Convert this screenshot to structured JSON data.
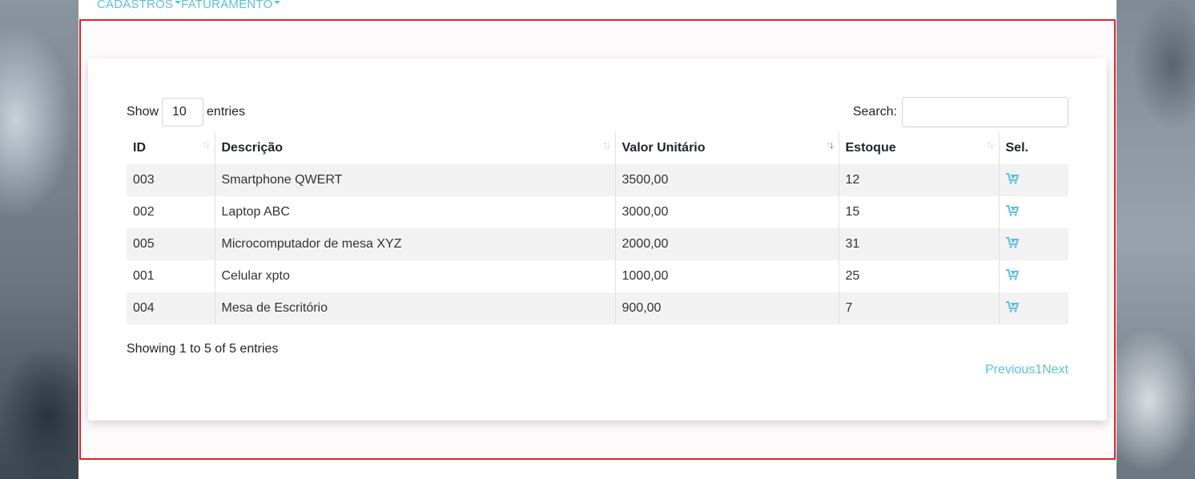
{
  "nav": {
    "items": [
      {
        "label": "CADASTROS"
      },
      {
        "label": "FATURAMENTO"
      }
    ]
  },
  "table_controls": {
    "show_label": "Show",
    "length_value": "10",
    "entries_label": "entries",
    "search_label": "Search:",
    "search_value": "",
    "search_placeholder": ""
  },
  "table": {
    "columns": [
      "ID",
      "Descrição",
      "Valor Unitário",
      "Estoque",
      "Sel."
    ],
    "rows": [
      {
        "id": "003",
        "descricao": "Smartphone QWERT",
        "valor": "3500,00",
        "estoque": "12"
      },
      {
        "id": "002",
        "descricao": "Laptop ABC",
        "valor": "3000,00",
        "estoque": "15"
      },
      {
        "id": "005",
        "descricao": "Microcomputador de mesa XYZ",
        "valor": "2000,00",
        "estoque": "31"
      },
      {
        "id": "001",
        "descricao": "Celular xpto",
        "valor": "1000,00",
        "estoque": "25"
      },
      {
        "id": "004",
        "descricao": "Mesa de Escritório",
        "valor": "900,00",
        "estoque": "7"
      }
    ],
    "select_icon": "cart-plus-icon"
  },
  "footer": {
    "info": "Showing 1 to 5 of 5 entries",
    "previous": "Previous",
    "page": "1",
    "next": "Next"
  },
  "colors": {
    "accent": "#5bc0de",
    "highlight_border": "#d8262a"
  }
}
